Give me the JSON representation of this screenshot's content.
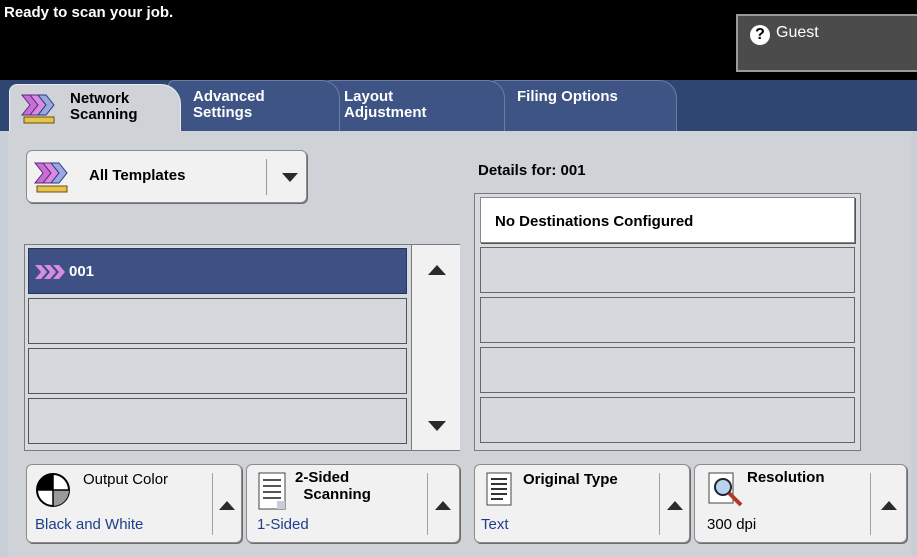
{
  "status": {
    "message": "Ready to scan your job.",
    "user": "Guest",
    "help_glyph": "?"
  },
  "tabs": [
    {
      "line1": "Network",
      "line2": "Scanning",
      "active": true
    },
    {
      "line1": "Advanced",
      "line2": "Settings"
    },
    {
      "line1": "Layout",
      "line2": "Adjustment"
    },
    {
      "line1": "Filing Options",
      "line2": ""
    }
  ],
  "templates": {
    "selector_label": "All Templates",
    "rows": [
      "001",
      "",
      "",
      ""
    ]
  },
  "details": {
    "label": "Details for:",
    "value": "001",
    "rows": [
      "No Destinations Configured",
      "",
      "",
      "",
      ""
    ]
  },
  "bottom_buttons": {
    "output_color": {
      "label": "Output Color",
      "value": "Black and White"
    },
    "two_sided": {
      "label_line1": "2-Sided",
      "label_line2": "Scanning",
      "value": "1-Sided"
    },
    "original_type": {
      "label": "Original Type",
      "value": "Text"
    },
    "resolution": {
      "label": "Resolution",
      "value": "300 dpi"
    }
  },
  "colors": {
    "selected_row": "#3d5185",
    "value_text": "#1f3e8a",
    "tab_strip": "#2f4672",
    "panel": "#cfd3d8"
  },
  "icons": [
    "help-icon",
    "network-scanning-icon",
    "all-templates-icon",
    "template-chevron-icon",
    "dropdown-arrow-icon",
    "scroll-up-icon",
    "scroll-down-icon",
    "output-color-icon",
    "two-sided-icon",
    "original-type-icon",
    "resolution-icon",
    "up-arrow-icon"
  ]
}
